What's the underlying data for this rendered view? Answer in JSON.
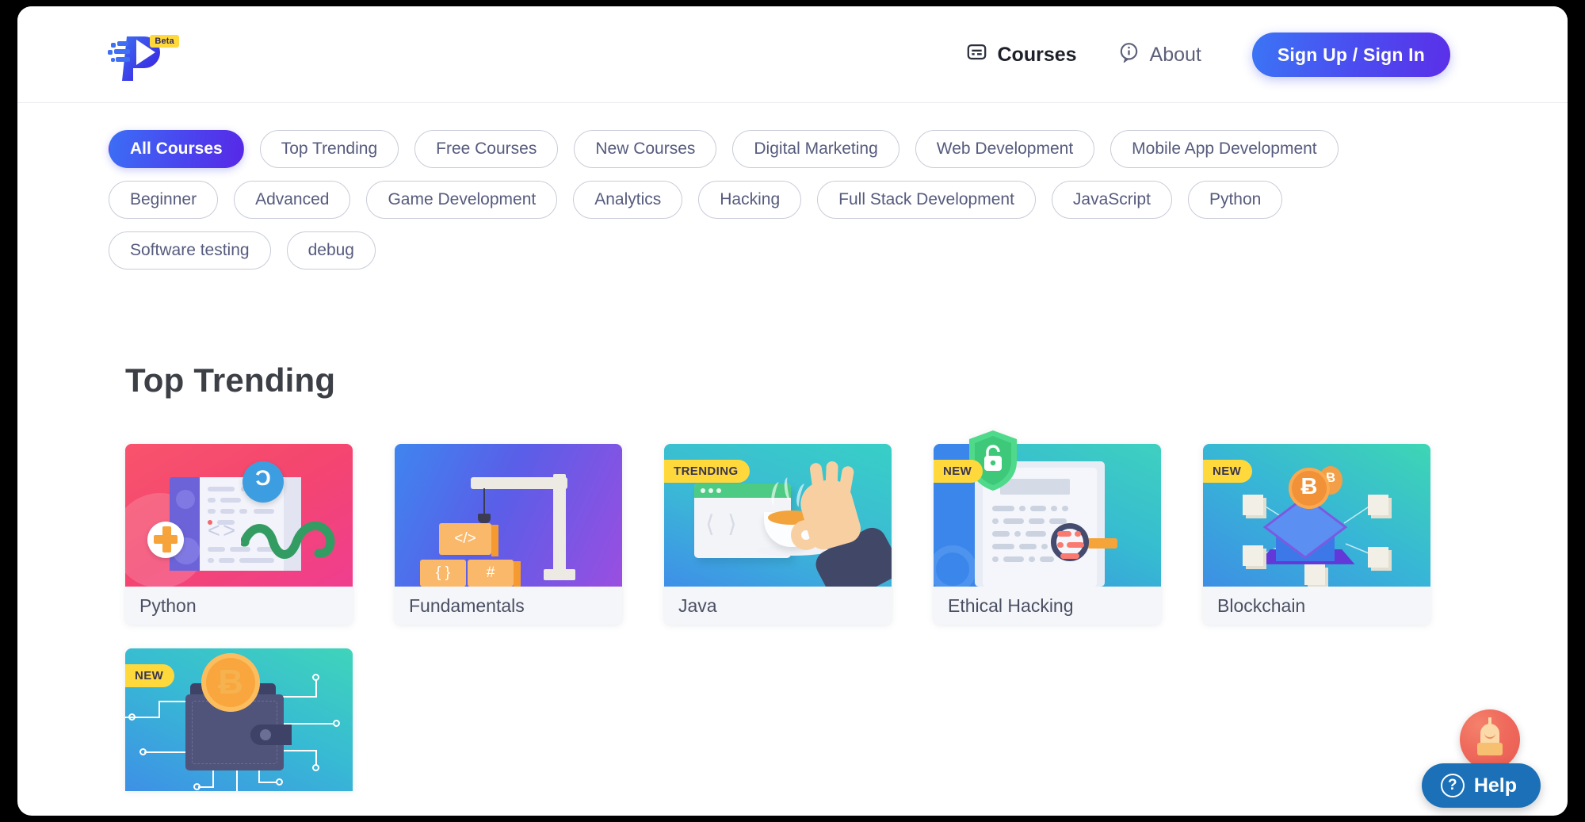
{
  "header": {
    "brand": {
      "name": "pesto-logo",
      "beta_label": "Beta"
    },
    "nav": [
      {
        "label": "Courses",
        "icon": "courses-icon",
        "active": true
      },
      {
        "label": "About",
        "icon": "info-icon",
        "active": false
      }
    ],
    "signin_label": "Sign Up / Sign In"
  },
  "filters": {
    "pills": [
      {
        "label": "All Courses",
        "active": true
      },
      {
        "label": "Top Trending",
        "active": false
      },
      {
        "label": "Free Courses",
        "active": false
      },
      {
        "label": "New Courses",
        "active": false
      },
      {
        "label": "Digital Marketing",
        "active": false
      },
      {
        "label": "Web Development",
        "active": false
      },
      {
        "label": "Mobile App Development",
        "active": false
      },
      {
        "label": "Beginner",
        "active": false
      },
      {
        "label": "Advanced",
        "active": false
      },
      {
        "label": "Game Development",
        "active": false
      },
      {
        "label": "Analytics",
        "active": false
      },
      {
        "label": "Hacking",
        "active": false
      },
      {
        "label": "Full Stack Development",
        "active": false
      },
      {
        "label": "JavaScript",
        "active": false
      },
      {
        "label": "Python",
        "active": false
      },
      {
        "label": "Software testing",
        "active": false
      },
      {
        "label": "debug",
        "active": false
      }
    ]
  },
  "main": {
    "section_title": "Top Trending",
    "cards": [
      {
        "title": "Python",
        "badge": "",
        "theme": "python"
      },
      {
        "title": "Fundamentals",
        "badge": "",
        "theme": "fundamentals"
      },
      {
        "title": "Java",
        "badge": "TRENDING",
        "theme": "java"
      },
      {
        "title": "Ethical Hacking",
        "badge": "NEW",
        "theme": "hacking"
      },
      {
        "title": "Blockchain",
        "badge": "NEW",
        "theme": "blockchain"
      },
      {
        "title": "",
        "badge": "NEW",
        "theme": "wallet"
      }
    ],
    "card_glyphs": {
      "python_badge": "Ɔ",
      "fundamentals_block_1": "</>",
      "fundamentals_block_2": "{ }",
      "fundamentals_block_3": "#",
      "java_chevrons": "⟨  ⟩",
      "blockchain_coin_main": "Ƀ",
      "blockchain_coin_small": "Ƀ",
      "wallet_coin": "Ƀ"
    }
  },
  "help": {
    "label": "Help",
    "icon": "question-mark-icon",
    "avatar": "robot-avatar"
  },
  "colors": {
    "accent_blue": "#4a4ef0",
    "accent_purple": "#5b2fe8",
    "badge_yellow": "#ffd93b",
    "pill_border": "#c9ccd8",
    "pill_text": "#565b7d",
    "card_label_bg": "#f5f6fa",
    "help_blue": "#1b70b8"
  }
}
